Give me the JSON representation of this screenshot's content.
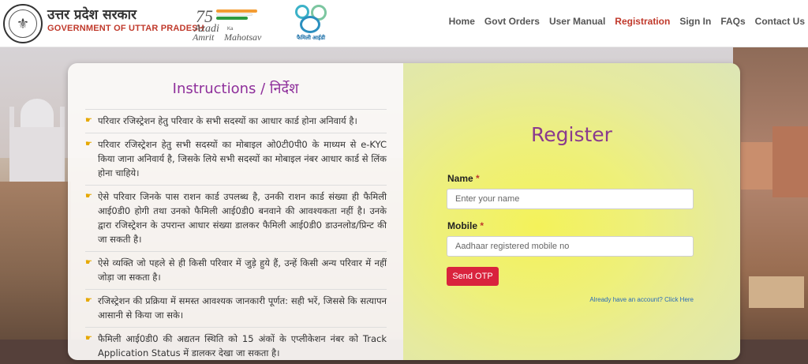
{
  "header": {
    "gov_hindi": "उत्तर प्रदेश सरकार",
    "gov_english": "GOVERNMENT OF UTTAR PRADESH",
    "azadi_logo": {
      "number": "75",
      "line1": "Azadi",
      "ka": "Ka",
      "line2a": "Amrit",
      "line2b": "Mahotsav"
    },
    "family_logo_label": "फैमिली आईडी",
    "nav": [
      {
        "label": "Home",
        "active": false
      },
      {
        "label": "Govt Orders",
        "active": false
      },
      {
        "label": "User Manual",
        "active": false
      },
      {
        "label": "Registration",
        "active": true
      },
      {
        "label": "Sign In",
        "active": false
      },
      {
        "label": "FAQs",
        "active": false
      },
      {
        "label": "Contact Us",
        "active": false
      }
    ]
  },
  "instructions": {
    "title": "Instructions / निर्देश",
    "items": [
      "परिवार रजिस्ट्रेशन हेतु परिवार के सभी सदस्यों का आधार कार्ड होना अनिवार्य है।",
      "परिवार रजिस्ट्रेशन हेतु सभी सदस्यों का मोबाइल ओ0टी0पी0 के माध्यम से e-KYC किया जाना अनिवार्य है, जिसके लिये सभी सदस्यों का मोबाइल नंबर आधार कार्ड से लिंक होना चाहिये।",
      "ऐसे परिवार जिनके पास राशन कार्ड उपलब्ध है, उनकी राशन कार्ड संख्या ही फैमिली आई0डी0 होगी तथा उनको फैमिली आई0डी0 बनवाने की आवश्यकता नहीं है। उनके द्वारा रजिस्ट्रेशन के उपरान्त आधार संख्या डालकर फैमिली आई0डी0 डाउनलोड/प्रिन्ट की जा सकती है।",
      "ऐसे व्यक्ति जो पहले से ही किसी परिवार में जुड़े हुये हैं, उन्हें किसी अन्य परिवार में नहीं जोड़ा जा सकता है।",
      "रजिस्ट्रेशन की प्रक्रिया में समस्त आवश्यक जानकारी पूर्णत: सही भरें, जिससे कि सत्यापन आसानी से किया जा सके।",
      "फैमिली आई0डी0 की अद्यतन स्थिति को 15 अंकों के एप्लीकेशन नंबर को Track Application Status में डालकर देखा जा सकता है।"
    ]
  },
  "register": {
    "title": "Register",
    "name_label": "Name",
    "name_placeholder": "Enter your name",
    "name_value": "",
    "mobile_label": "Mobile",
    "mobile_placeholder": "Aadhaar registered mobile no",
    "mobile_value": "",
    "required_mark": "*",
    "otp_button": "Send OTP",
    "login_link": "Already have an account? Click Here"
  },
  "colors": {
    "accent_red": "#c0392b",
    "title_purple": "#8e2f9b",
    "button_red": "#d9233d",
    "link_blue": "#2a6bb8"
  }
}
